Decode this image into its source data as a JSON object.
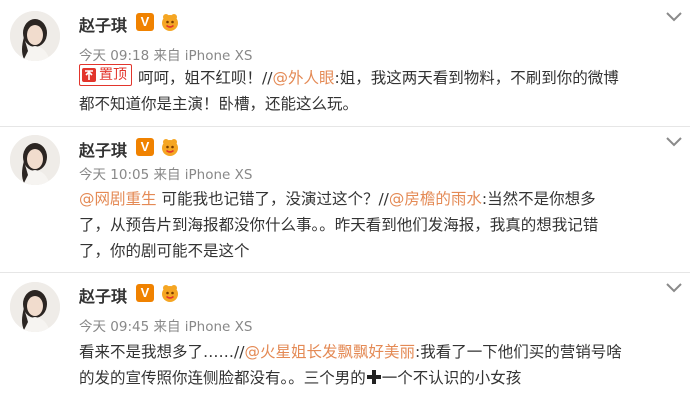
{
  "posts": [
    {
      "username": "赵子琪",
      "vip_label": "V",
      "time": "今天 09:18 来自 iPhone XS",
      "pinned_label": "置顶",
      "text_1": "呵呵，姐不红呗！",
      "sep_1": "//",
      "mention_1": "@外人眼",
      "text_2": ":姐，我这两天看到物料，不刷到你的微博",
      "text_3": "都不知道你是主演！卧槽，还能这么玩。"
    },
    {
      "username": "赵子琪",
      "vip_label": "V",
      "time": "今天 10:05 来自 iPhone XS",
      "mention_1": "@网剧重生",
      "text_1": " 可能我也记错了，没演过这个？",
      "sep_1": "//",
      "mention_2": "@房檐的雨水",
      "text_2": ":当然不是你想多",
      "text_3": "了，从预告片到海报都没你什么事。。昨天看到他们发海报，我真的想我记错",
      "text_4": "了，你的剧可能不是这个"
    },
    {
      "username": "赵子琪",
      "vip_label": "V",
      "time": "今天 09:45 来自 iPhone XS",
      "text_1": "看来不是我想多了……",
      "sep_1": "//",
      "mention_1": "@火星姐长发飘飘好美丽",
      "text_2": ":我看了一下他们买的营销号啥",
      "text_3": "的发的宣传照你连侧脸都没有。。三个男的",
      "text_4": "一个不认识的小女孩"
    }
  ],
  "icons": {
    "vip": "verified-v-icon",
    "fan": "fan-badge-icon",
    "pin": "pin-icon",
    "more": "chevron-down-icon",
    "cross": "cross-emoji-icon"
  },
  "colors": {
    "mention": "#e48a55",
    "vip": "#f08200",
    "pin": "#e2352c",
    "meta": "#888888"
  }
}
